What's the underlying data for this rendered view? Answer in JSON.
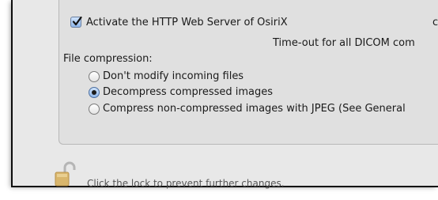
{
  "http_server": {
    "checked": true,
    "label": "Activate the HTTP Web Server of OsiriX",
    "clipped_suffix": "c"
  },
  "timeout_label": "Time-out for all DICOM com",
  "file_compression": {
    "heading": "File compression:",
    "options": [
      {
        "label": "Don't modify incoming files",
        "selected": false
      },
      {
        "label": "Decompress compressed images",
        "selected": true
      },
      {
        "label": "Compress non-compressed images with JPEG (See General",
        "selected": false
      }
    ]
  },
  "lock": {
    "icon": "lock-open-icon",
    "message": "Click the lock to prevent further changes."
  }
}
